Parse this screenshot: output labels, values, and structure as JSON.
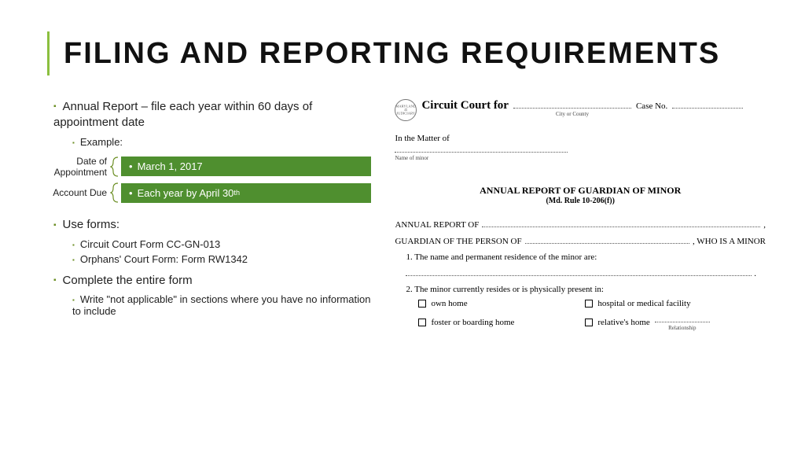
{
  "title": "FILING AND REPORTING REQUIREMENTS",
  "left": {
    "b1": "Annual Report – file each year within 60 days of appointment date",
    "b1_sub1": "Example:",
    "row1_label": "Date of Appointment",
    "row1_value": "March 1, 2017",
    "row2_label": "Account Due",
    "row2_value_pre": "Each year by April 30",
    "row2_value_sup": "th",
    "b2": "Use forms:",
    "b2_sub1": "Circuit Court Form CC-GN-013",
    "b2_sub2": "Orphans' Court Form: Form RW1342",
    "b3": "Complete the entire form",
    "b3_sub1": "Write \"not applicable\" in sections where you have no information to include"
  },
  "form": {
    "seal_top": "MARYLAND",
    "seal_bottom": "JUDICIARY",
    "court_for": "Circuit Court for",
    "city_county": "City or County",
    "case_no": "Case No.",
    "in_matter": "In the Matter of",
    "name_minor": "Name of minor",
    "title": "ANNUAL REPORT OF GUARDIAN OF MINOR",
    "rule": "(Md. Rule 10-206(f))",
    "line1_pre": "ANNUAL REPORT OF",
    "line1_post": ",",
    "line2_pre": "GUARDIAN OF THE PERSON OF",
    "line2_post": ", WHO IS A MINOR",
    "q1": "1.  The name and permanent residence of the minor are:",
    "q2": "2.  The minor currently resides or is physically present in:",
    "c1": "own home",
    "c2": "hospital or medical facility",
    "c3": "foster or boarding home",
    "c4": "relative's home",
    "rel": "Relationship"
  }
}
